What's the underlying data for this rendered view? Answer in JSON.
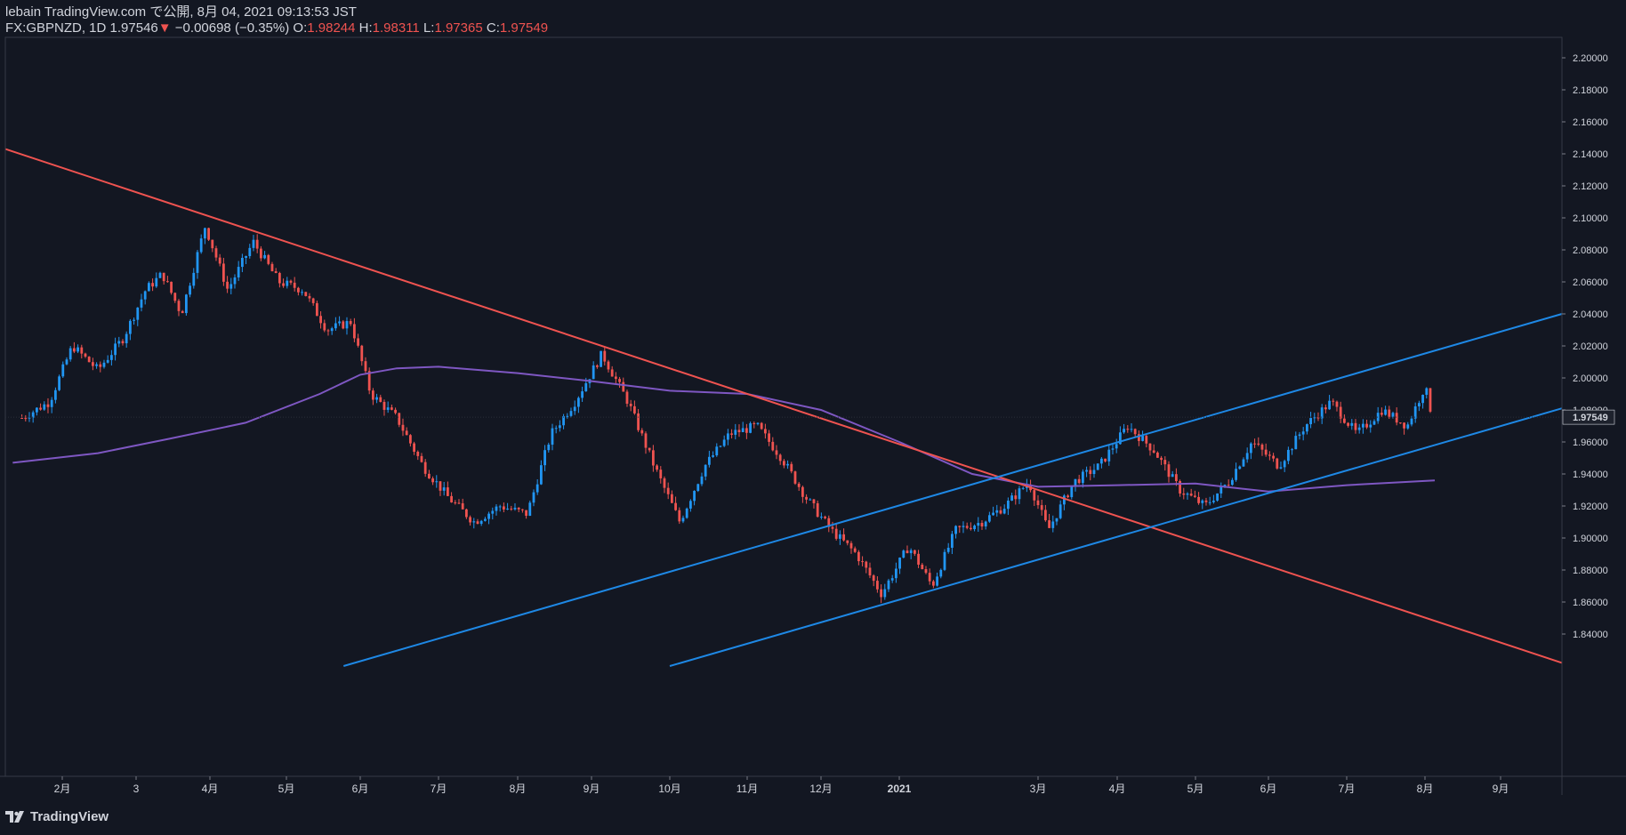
{
  "header": {
    "publisher_line": "lebain TradingView.com で公開, 8月 04, 2021 09:13:53 JST",
    "symbol": "FX:GBPNZD, 1D",
    "last": "1.97546",
    "change": "−0.00698 (−0.35%)",
    "open_label": "O:",
    "open": "1.98244",
    "high_label": "H:",
    "high": "1.98311",
    "low_label": "L:",
    "low": "1.97365",
    "close_label": "C:",
    "close": "1.97549"
  },
  "footer": {
    "brand": "TradingView"
  },
  "colors": {
    "background": "#131722",
    "up": "#2196f3",
    "down": "#ef5350",
    "ma": "#7e57c2",
    "trend_red": "#ef5350",
    "channel_blue": "#1e88e5"
  },
  "chart_data": {
    "type": "candlestick",
    "symbol": "FX:GBPNZD",
    "interval": "1D",
    "ylim": [
      1.82,
      2.21
    ],
    "y_ticks": [
      "2.20000",
      "2.18000",
      "2.16000",
      "2.14000",
      "2.12000",
      "2.10000",
      "2.08000",
      "2.06000",
      "2.04000",
      "2.02000",
      "2.00000",
      "1.98000",
      "1.96000",
      "1.94000",
      "1.92000",
      "1.90000",
      "1.88000",
      "1.86000",
      "1.84000"
    ],
    "x_ticks": [
      "2月",
      "3",
      "4月",
      "5月",
      "6月",
      "7月",
      "8月",
      "9月",
      "10月",
      "11月",
      "12月",
      "2021",
      "3月",
      "4月",
      "5月",
      "6月",
      "7月",
      "8月",
      "9月"
    ],
    "last_price_label": "1.97549",
    "price_points": [
      {
        "x": "2020-01-10",
        "y": 1.975
      },
      {
        "x": "2020-01-25",
        "y": 1.985
      },
      {
        "x": "2020-02-05",
        "y": 2.02
      },
      {
        "x": "2020-02-15",
        "y": 2.005
      },
      {
        "x": "2020-02-25",
        "y": 2.025
      },
      {
        "x": "2020-03-05",
        "y": 2.055
      },
      {
        "x": "2020-03-12",
        "y": 2.065
      },
      {
        "x": "2020-03-20",
        "y": 2.04
      },
      {
        "x": "2020-03-30",
        "y": 2.095
      },
      {
        "x": "2020-04-08",
        "y": 2.055
      },
      {
        "x": "2020-04-18",
        "y": 2.085
      },
      {
        "x": "2020-04-28",
        "y": 2.06
      },
      {
        "x": "2020-05-08",
        "y": 2.055
      },
      {
        "x": "2020-05-18",
        "y": 2.03
      },
      {
        "x": "2020-05-28",
        "y": 2.035
      },
      {
        "x": "2020-06-05",
        "y": 1.99
      },
      {
        "x": "2020-06-15",
        "y": 1.975
      },
      {
        "x": "2020-06-25",
        "y": 1.945
      },
      {
        "x": "2020-07-05",
        "y": 1.925
      },
      {
        "x": "2020-07-15",
        "y": 1.91
      },
      {
        "x": "2020-07-25",
        "y": 1.92
      },
      {
        "x": "2020-08-05",
        "y": 1.915
      },
      {
        "x": "2020-08-15",
        "y": 1.965
      },
      {
        "x": "2020-08-25",
        "y": 1.985
      },
      {
        "x": "2020-09-05",
        "y": 2.015
      },
      {
        "x": "2020-09-15",
        "y": 1.985
      },
      {
        "x": "2020-09-25",
        "y": 1.945
      },
      {
        "x": "2020-10-05",
        "y": 1.91
      },
      {
        "x": "2020-10-15",
        "y": 1.945
      },
      {
        "x": "2020-10-25",
        "y": 1.965
      },
      {
        "x": "2020-11-05",
        "y": 1.97
      },
      {
        "x": "2020-11-15",
        "y": 1.95
      },
      {
        "x": "2020-11-25",
        "y": 1.925
      },
      {
        "x": "2020-12-05",
        "y": 1.905
      },
      {
        "x": "2020-12-15",
        "y": 1.89
      },
      {
        "x": "2020-12-25",
        "y": 1.865
      },
      {
        "x": "2021-01-05",
        "y": 1.895
      },
      {
        "x": "2021-01-15",
        "y": 1.87
      },
      {
        "x": "2021-01-25",
        "y": 1.905
      },
      {
        "x": "2021-02-05",
        "y": 1.91
      },
      {
        "x": "2021-02-15",
        "y": 1.92
      },
      {
        "x": "2021-02-25",
        "y": 1.935
      },
      {
        "x": "2021-03-05",
        "y": 1.905
      },
      {
        "x": "2021-03-15",
        "y": 1.935
      },
      {
        "x": "2021-03-25",
        "y": 1.945
      },
      {
        "x": "2021-04-05",
        "y": 1.97
      },
      {
        "x": "2021-04-15",
        "y": 1.955
      },
      {
        "x": "2021-04-25",
        "y": 1.93
      },
      {
        "x": "2021-05-05",
        "y": 1.92
      },
      {
        "x": "2021-05-15",
        "y": 1.935
      },
      {
        "x": "2021-05-25",
        "y": 1.96
      },
      {
        "x": "2021-06-05",
        "y": 1.945
      },
      {
        "x": "2021-06-15",
        "y": 1.97
      },
      {
        "x": "2021-06-25",
        "y": 1.985
      },
      {
        "x": "2021-07-05",
        "y": 1.965
      },
      {
        "x": "2021-07-15",
        "y": 1.98
      },
      {
        "x": "2021-07-25",
        "y": 1.97
      },
      {
        "x": "2021-08-01",
        "y": 1.995
      },
      {
        "x": "2021-08-04",
        "y": 1.9755
      }
    ],
    "moving_average": [
      {
        "x": "2020-01-05",
        "y": 1.947
      },
      {
        "x": "2020-02-15",
        "y": 1.953
      },
      {
        "x": "2020-03-15",
        "y": 1.962
      },
      {
        "x": "2020-04-15",
        "y": 1.972
      },
      {
        "x": "2020-05-15",
        "y": 1.99
      },
      {
        "x": "2020-06-01",
        "y": 2.002
      },
      {
        "x": "2020-06-15",
        "y": 2.006
      },
      {
        "x": "2020-07-01",
        "y": 2.007
      },
      {
        "x": "2020-08-01",
        "y": 2.003
      },
      {
        "x": "2020-09-01",
        "y": 1.998
      },
      {
        "x": "2020-10-01",
        "y": 1.992
      },
      {
        "x": "2020-11-01",
        "y": 1.99
      },
      {
        "x": "2020-12-01",
        "y": 1.98
      },
      {
        "x": "2021-01-01",
        "y": 1.96
      },
      {
        "x": "2021-02-01",
        "y": 1.94
      },
      {
        "x": "2021-03-01",
        "y": 1.932
      },
      {
        "x": "2021-04-01",
        "y": 1.933
      },
      {
        "x": "2021-05-01",
        "y": 1.934
      },
      {
        "x": "2021-06-01",
        "y": 1.929
      },
      {
        "x": "2021-07-01",
        "y": 1.933
      },
      {
        "x": "2021-08-05",
        "y": 1.936
      }
    ],
    "trendlines": [
      {
        "color": "red",
        "from": {
          "x": "2020-01-01",
          "y": 2.143
        },
        "to": {
          "x": "2021-10-05",
          "y": 1.822
        }
      },
      {
        "color": "blue",
        "from": {
          "x": "2020-05-25",
          "y": 1.82
        },
        "to": {
          "x": "2021-10-05",
          "y": 2.04
        }
      },
      {
        "color": "blue",
        "from": {
          "x": "2020-10-01",
          "y": 1.82
        },
        "to": {
          "x": "2021-10-05",
          "y": 1.981
        }
      }
    ]
  }
}
